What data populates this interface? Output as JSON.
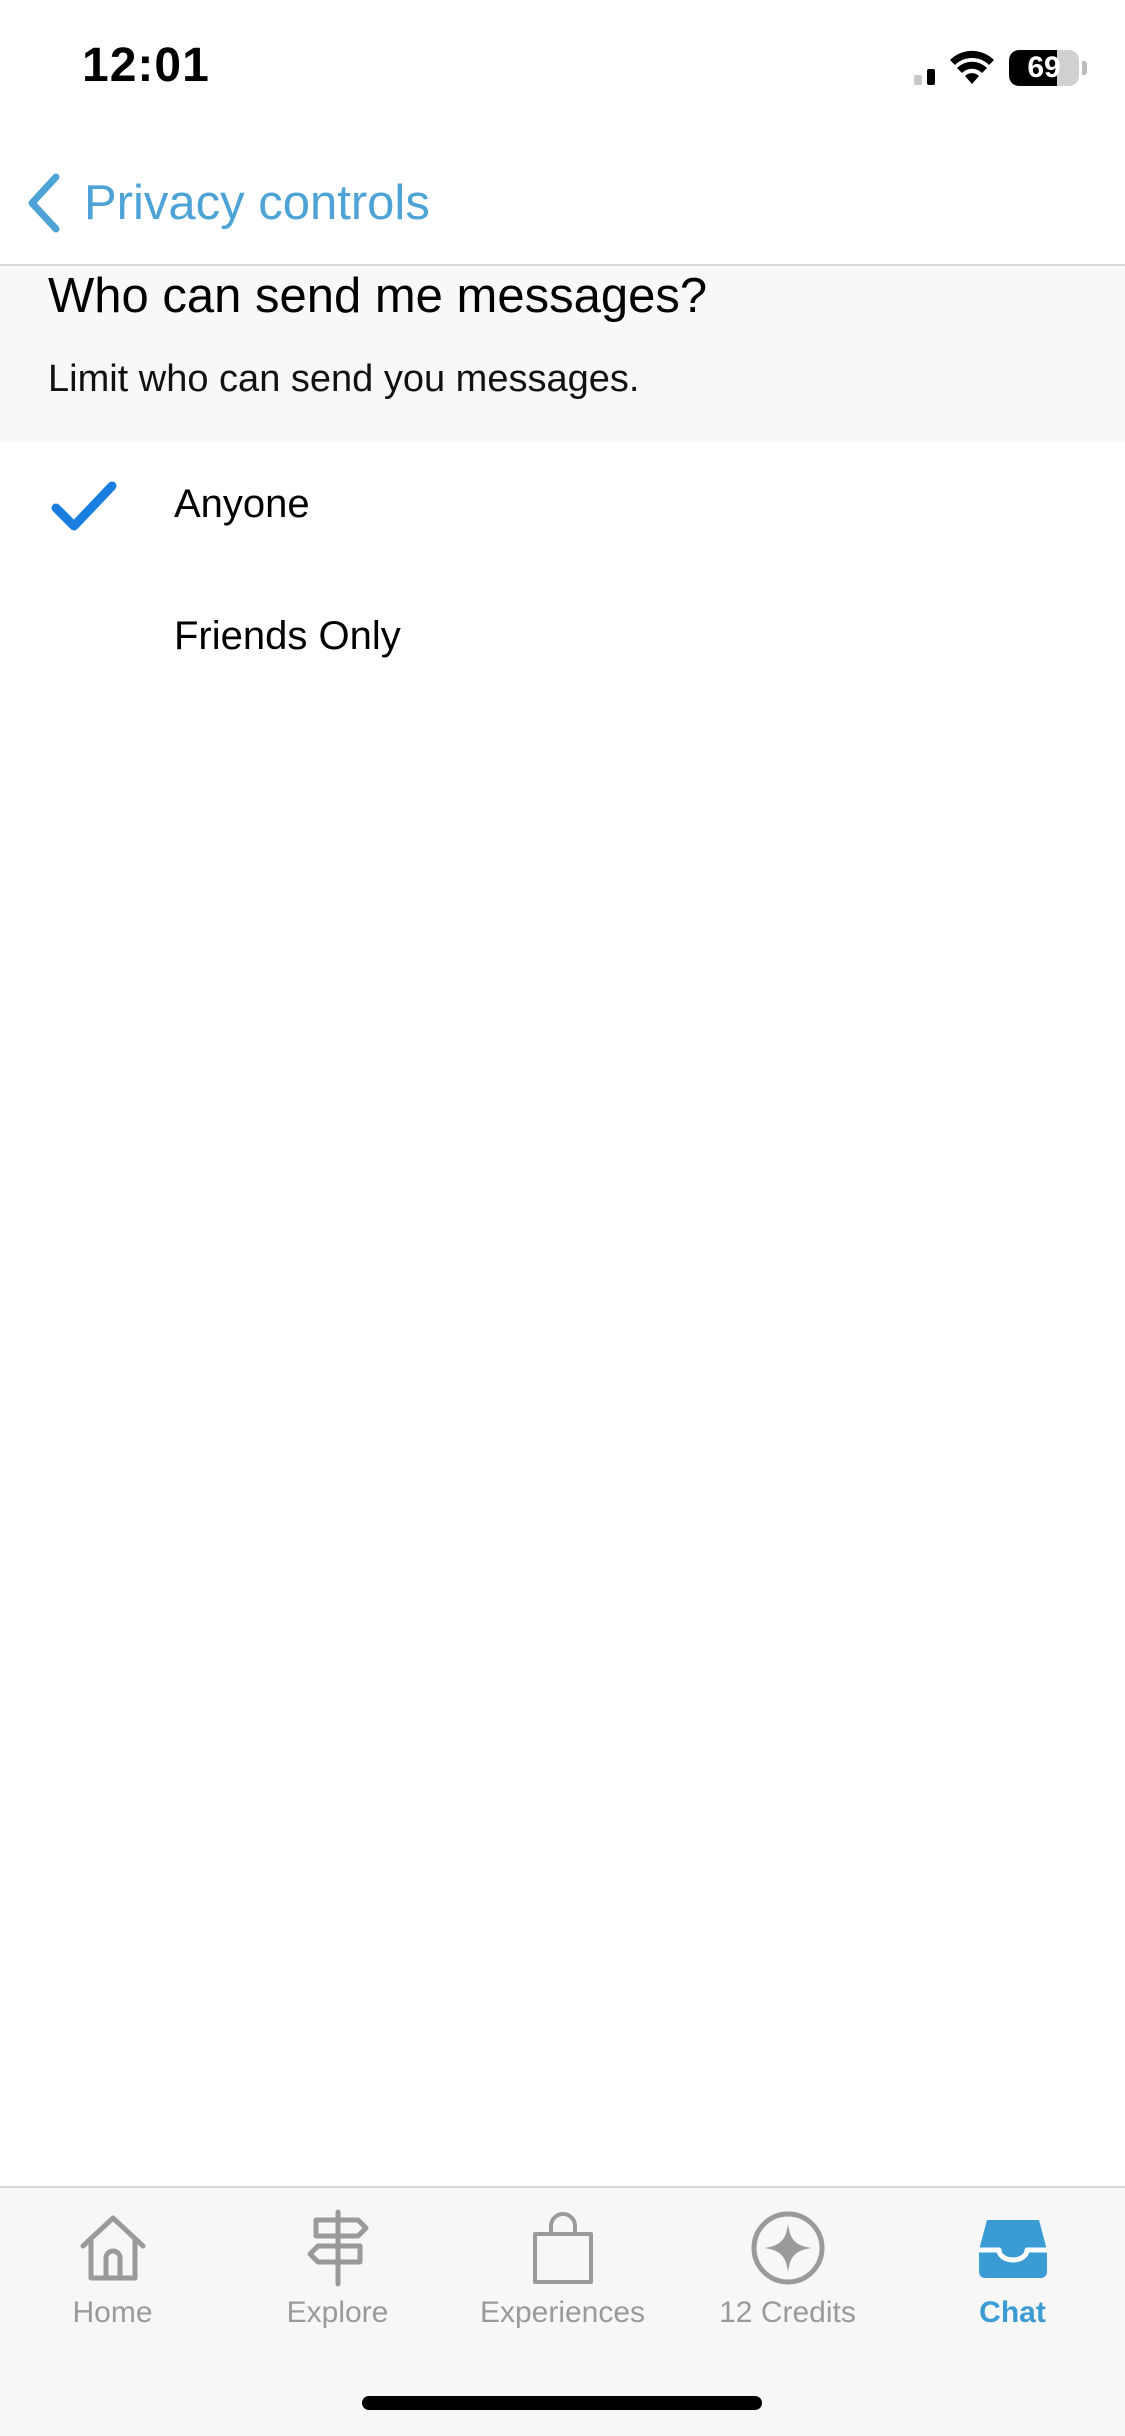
{
  "status_bar": {
    "time": "12:01",
    "battery": "69",
    "battery_level": 0.69
  },
  "nav": {
    "back_label": "Privacy controls"
  },
  "section": {
    "title": "Who can send me messages?",
    "subtitle": "Limit who can send you messages."
  },
  "options": [
    {
      "label": "Anyone",
      "selected": true
    },
    {
      "label": "Friends Only",
      "selected": false
    }
  ],
  "tabs": [
    {
      "label": "Home",
      "icon": "home-icon",
      "active": false
    },
    {
      "label": "Explore",
      "icon": "signpost-icon",
      "active": false
    },
    {
      "label": "Experiences",
      "icon": "shopping-bag-icon",
      "active": false
    },
    {
      "label": "12 Credits",
      "icon": "sparkle-coin-icon",
      "active": false
    },
    {
      "label": "Chat",
      "icon": "inbox-tray-icon",
      "active": true
    }
  ],
  "colors": {
    "accent": "#4da3d6",
    "check": "#1a7ee0",
    "tab_inactive": "#9a9a9a",
    "tab_active": "#3a9bd5"
  }
}
